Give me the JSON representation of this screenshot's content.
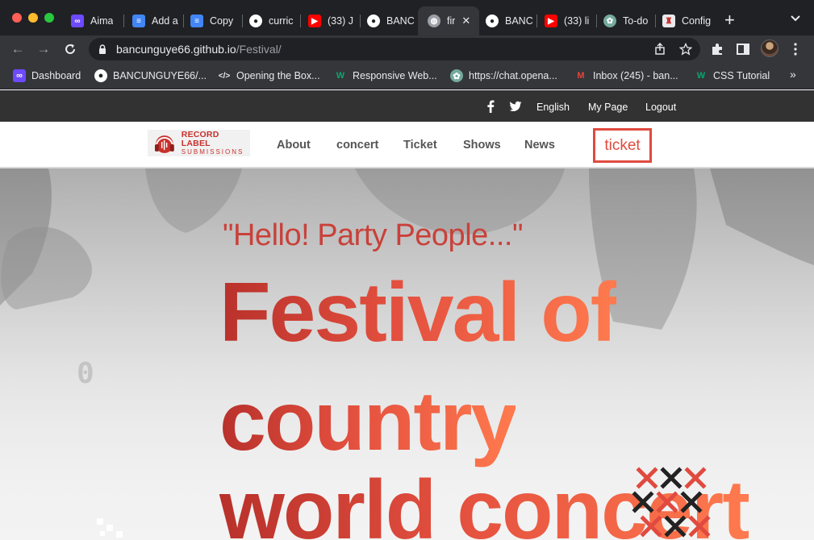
{
  "browser": {
    "tabs": [
      {
        "label": "Aima",
        "icon": "aima-icon"
      },
      {
        "label": "Add a",
        "icon": "google-docs-icon"
      },
      {
        "label": "Copy",
        "icon": "google-docs-icon"
      },
      {
        "label": "curric",
        "icon": "github-icon"
      },
      {
        "label": "(33) J",
        "icon": "youtube-icon"
      },
      {
        "label": "BANC",
        "icon": "github-icon"
      },
      {
        "label": "fir",
        "icon": "globe-icon",
        "active": true
      },
      {
        "label": "BANC",
        "icon": "github-icon"
      },
      {
        "label": "(33) li",
        "icon": "youtube-icon"
      },
      {
        "label": "To-do",
        "icon": "chatgpt-icon"
      },
      {
        "label": "Config",
        "icon": "config-icon"
      }
    ],
    "new_tab": "+",
    "url": {
      "host": "bancunguye66.github.io",
      "path": "/Festival/"
    },
    "bookmarks": [
      {
        "label": "Dashboard",
        "icon": "aima-icon"
      },
      {
        "label": "BANCUNGUYE66/...",
        "icon": "github-icon"
      },
      {
        "label": "Opening the Box...",
        "icon": "code-icon"
      },
      {
        "label": "Responsive Web...",
        "icon": "w3-icon"
      },
      {
        "label": "https://chat.opena...",
        "icon": "chatgpt-icon"
      },
      {
        "label": "Inbox (245) - ban...",
        "icon": "gmail-icon"
      },
      {
        "label": "CSS Tutorial",
        "icon": "w3-icon"
      }
    ],
    "bookmarks_more": "»"
  },
  "site": {
    "topbar": {
      "links": [
        "English",
        "My Page",
        "Logout"
      ],
      "social": [
        "facebook-icon",
        "twitter-icon"
      ]
    },
    "logo": {
      "line1": "RECORD LABEL",
      "line2": "SUBMISSIONS"
    },
    "nav": [
      "About",
      "concert",
      "Ticket",
      "Shows",
      "News"
    ],
    "ticket_button": "ticket",
    "hero": {
      "greeting": "\"Hello! Party People...\"",
      "title_lines": [
        "Festival of",
        "country",
        "world concert"
      ],
      "counter": "0"
    }
  },
  "colors": {
    "accent": "#e04a3f",
    "topbar": "#323232",
    "chrome_dark": "#202124",
    "chrome_mid": "#35363a"
  }
}
